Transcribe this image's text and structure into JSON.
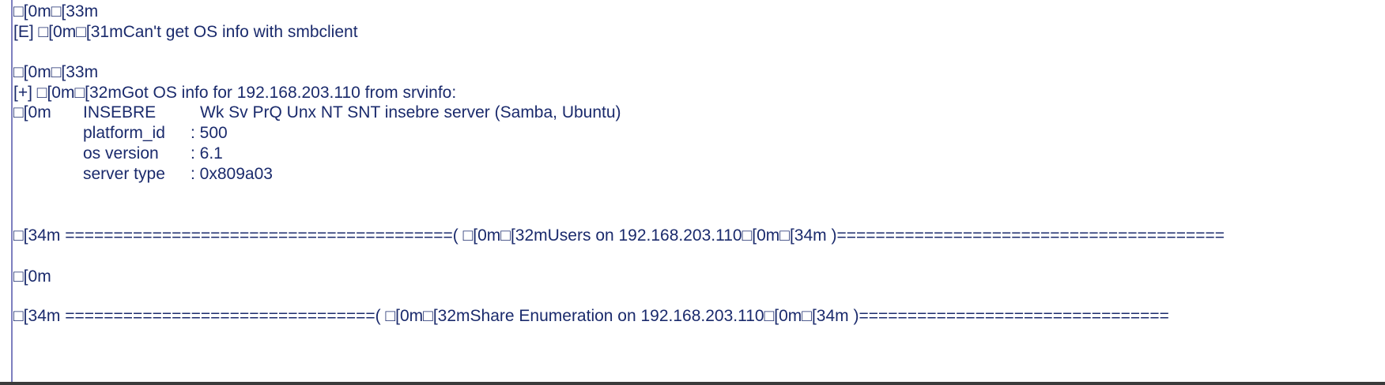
{
  "colors": {
    "text": "#1a2a6c",
    "left_border": "#7d7fbf",
    "bottom_border": "#3a3a3a",
    "background": "#ffffff"
  },
  "lines": {
    "l1": "□[0m□[33m",
    "l2": "[E] □[0m□[31mCan't get OS info with smbclient",
    "l3": "□[0m□[33m",
    "l4": "[+] □[0m□[32mGot OS info for 192.168.203.110 from srvinfo:",
    "l5": {
      "prefix": "□[0m",
      "name": "INSEBRE",
      "desc": "Wk Sv PrQ Unx NT SNT insebre server (Samba, Ubuntu)"
    },
    "l6": {
      "label": "platform_id",
      "value": ": 500"
    },
    "l7": {
      "label": "os version",
      "value": ": 6.1"
    },
    "l8": {
      "label": "server type",
      "value": ": 0x809a03"
    },
    "l9": "□[34m ========================================( □[0m□[32mUsers on 192.168.203.110□[0m□[34m )========================================",
    "l10": "□[0m",
    "l11": "□[34m ================================( □[0m□[32mShare Enumeration on 192.168.203.110□[0m□[34m )================================"
  }
}
